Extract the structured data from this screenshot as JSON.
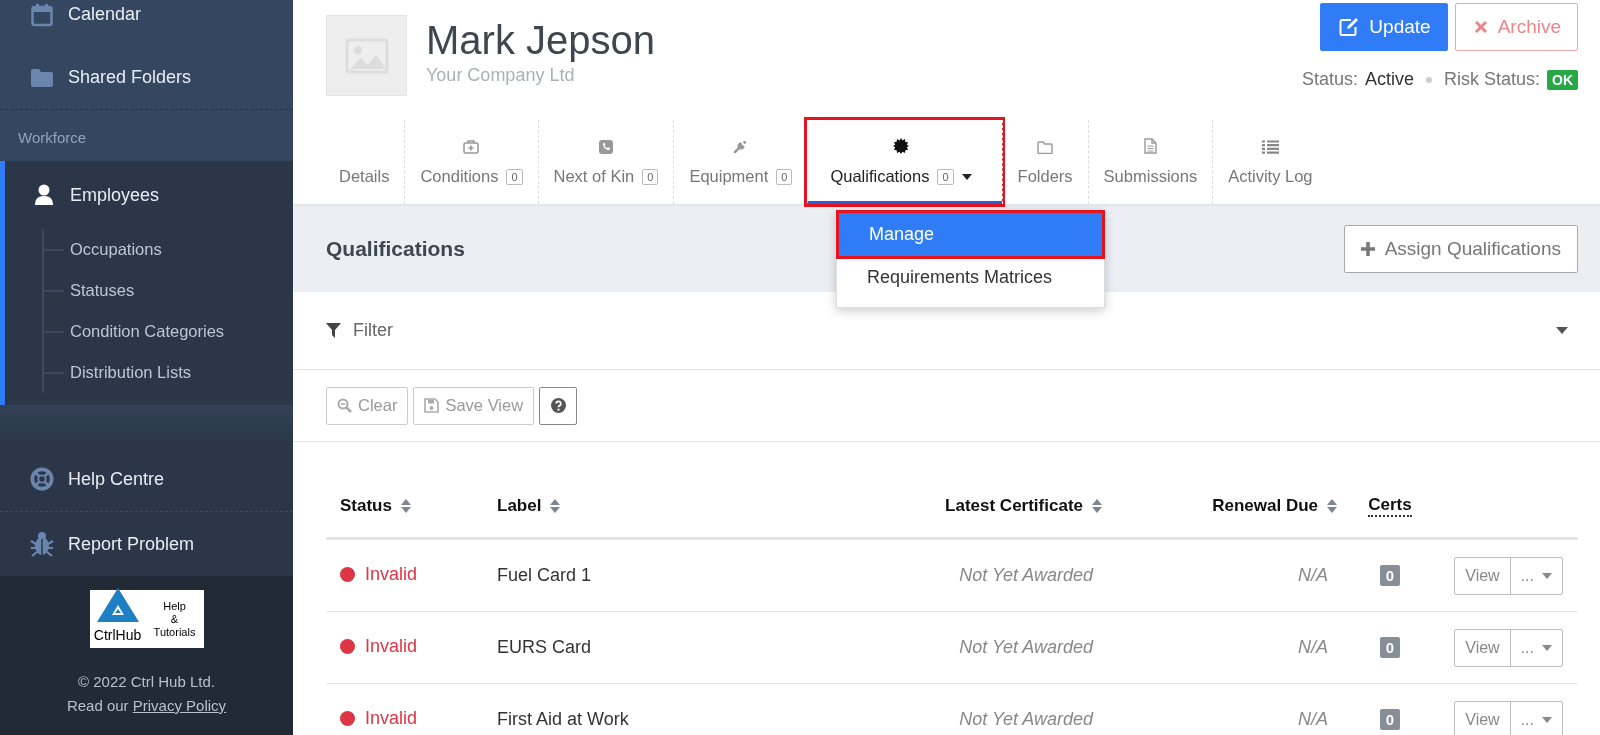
{
  "sidebar": {
    "items": [
      {
        "label": "Calendar",
        "selected": false
      },
      {
        "label": "Shared Folders",
        "selected": false
      }
    ],
    "section": {
      "label": "Workforce",
      "items": [
        {
          "label": "Employees",
          "selected": true,
          "children": [
            {
              "label": "Occupations",
              "selected": false
            },
            {
              "label": "Statuses",
              "selected": false
            },
            {
              "label": "Condition Categories",
              "selected": false
            },
            {
              "label": "Distribution Lists",
              "selected": false
            }
          ]
        }
      ]
    },
    "bottom_items": [
      {
        "label": "Help Centre",
        "selected": false
      },
      {
        "label": "Report Problem",
        "selected": false
      }
    ],
    "logo": {
      "brand": "CtrlHub",
      "lines": [
        "Help",
        "&",
        "Tutorials"
      ]
    },
    "copyright": "© 2022 Ctrl Hub Ltd.",
    "privacy": {
      "prefix": "Read our",
      "link": "Privacy Policy"
    }
  },
  "profile": {
    "name": "Mark Jepson",
    "company": "Your Company Ltd",
    "buttons": [
      {
        "label": "Update",
        "kind": "primary"
      },
      {
        "label": "Archive",
        "kind": "danger"
      }
    ],
    "status_label": "Status:",
    "status": "Active",
    "risk_label": "Risk Status:",
    "risk": "OK"
  },
  "tabs": [
    {
      "label": "Details",
      "selected": false,
      "annotated": false,
      "dropdown": false
    },
    {
      "label": "Conditions",
      "count": "0",
      "selected": false,
      "annotated": false,
      "dropdown": false
    },
    {
      "label": "Next of Kin",
      "count": "0",
      "selected": false,
      "annotated": false,
      "dropdown": false
    },
    {
      "label": "Equipment",
      "count": "0",
      "selected": false,
      "annotated": false,
      "dropdown": false
    },
    {
      "label": "Qualifications",
      "count": "0",
      "selected": true,
      "annotated": true,
      "dropdown": true
    },
    {
      "label": "Folders",
      "selected": false,
      "annotated": false,
      "dropdown": false
    },
    {
      "label": "Submissions",
      "selected": false,
      "annotated": false,
      "dropdown": false
    },
    {
      "label": "Activity Log",
      "selected": false,
      "annotated": false,
      "dropdown": false
    }
  ],
  "tab_menu": {
    "items": [
      {
        "label": "Manage",
        "selected": true,
        "annotated": true
      },
      {
        "label": "Requirements Matrices",
        "selected": false,
        "annotated": false
      }
    ]
  },
  "panel": {
    "title": "Qualifications",
    "action": "Assign Qualifications"
  },
  "filter": {
    "label": "Filter",
    "expanded": false
  },
  "toolbar": {
    "buttons": [
      {
        "label": "Clear",
        "disabled": true
      },
      {
        "label": "Save View",
        "disabled": true
      }
    ]
  },
  "table": {
    "columns": [
      {
        "label": "Status",
        "sortable": true
      },
      {
        "label": "Label",
        "sortable": true
      },
      {
        "label": "Latest Certificate",
        "sortable": true
      },
      {
        "label": "Renewal Due",
        "sortable": true
      },
      {
        "label": "Certs",
        "sortable": false
      }
    ],
    "rows": [
      {
        "status": "Invalid",
        "color": "#dc3545",
        "label": "Fuel Card 1",
        "latest_certificate": "Not Yet Awarded",
        "renewal_due": "N/A",
        "certs": "0",
        "view": "View",
        "more": "..."
      },
      {
        "status": "Invalid",
        "color": "#dc3545",
        "label": "EURS Card",
        "latest_certificate": "Not Yet Awarded",
        "renewal_due": "N/A",
        "certs": "0",
        "view": "View",
        "more": "..."
      },
      {
        "status": "Invalid",
        "color": "#dc3545",
        "label": "First Aid at Work",
        "latest_certificate": "Not Yet Awarded",
        "renewal_due": "N/A",
        "certs": "0",
        "view": "View",
        "more": "..."
      }
    ]
  }
}
